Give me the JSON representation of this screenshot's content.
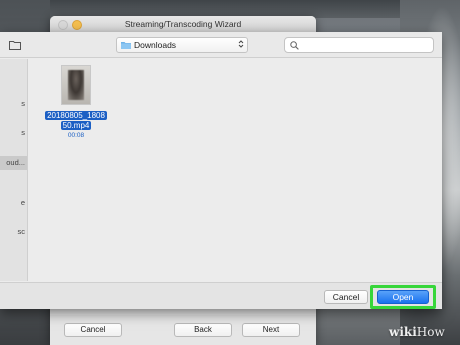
{
  "wizard": {
    "title": "Streaming/Transcoding Wizard",
    "cancel_label": "Cancel",
    "back_label": "Back",
    "next_label": "Next"
  },
  "sheet": {
    "location": "Downloads",
    "search_placeholder": "",
    "sidebar_fragments": [
      "s",
      "s",
      "oud...",
      "e",
      "sc"
    ],
    "file": {
      "name_line1": "20180805_1808",
      "name_line2": "50.mp4",
      "duration": "00:08"
    },
    "cancel_label": "Cancel",
    "open_label": "Open"
  },
  "colors": {
    "selection": "#1b5fc4",
    "open_button": "#1a72ef",
    "highlight": "#37d63a"
  },
  "watermark": {
    "prefix": "wiki",
    "suffix": "How"
  }
}
